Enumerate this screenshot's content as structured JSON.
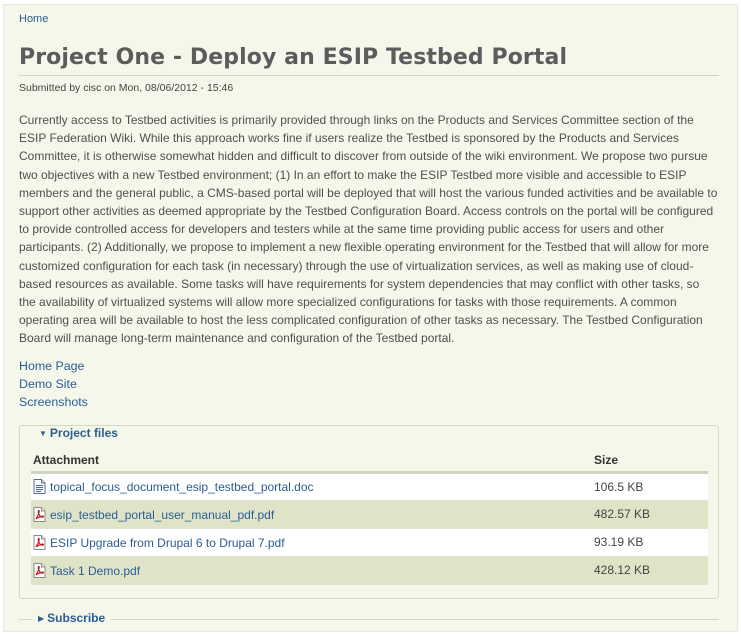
{
  "breadcrumb": {
    "home_label": "Home"
  },
  "node": {
    "title": "Project One - Deploy an ESIP Testbed Portal",
    "submitted": "Submitted by cisc on Mon, 08/06/2012 - 15:46",
    "body": "Currently access to Testbed activities is primarily provided through links on the Products and Services Committee section of the ESIP Federation Wiki. While this approach works fine if users realize the Testbed is sponsored by the Products and Services Committee, it is otherwise somewhat hidden and difficult to discover from outside of the wiki environment. We propose two pursue two objectives with a new Testbed environment; (1) In an effort to make the ESIP Testbed more visible and accessible to ESIP members and the general public, a CMS-based portal will be deployed that will host the various funded activities and be available to support other activities as deemed appropriate by the Testbed Configuration Board. Access controls on the portal will be configured to provide controlled access for developers and testers while at the same time providing public access for users and other participants. (2) Additionally, we propose to implement a new flexible operating environment for the Testbed that will allow for more customized configuration for each task (in necessary) through the use of virtualization services, as well as making use of cloud-based resources as available. Some tasks will have requirements for system dependencies that may conflict with other tasks, so the availability of virtualized systems will allow more specialized configurations for tasks with those requirements. A common operating area will be available to host the less complicated configuration of other tasks as necessary. The Testbed Configuration Board will manage long-term maintenance and configuration of the Testbed portal.",
    "links": [
      "Home Page",
      "Demo Site",
      "Screenshots"
    ]
  },
  "project_files": {
    "legend": "Project files",
    "columns": {
      "attachment": "Attachment",
      "size": "Size"
    },
    "rows": [
      {
        "name": "topical_focus_document_esip_testbed_portal.doc",
        "size": "106.5 KB",
        "icon": "doc-file-icon"
      },
      {
        "name": "esip_testbed_portal_user_manual_pdf.pdf",
        "size": "482.57 KB",
        "icon": "pdf-file-icon"
      },
      {
        "name": "ESIP Upgrade from Drupal 6 to Drupal 7.pdf",
        "size": "93.19 KB",
        "icon": "pdf-file-icon"
      },
      {
        "name": "Task 1 Demo.pdf",
        "size": "428.12 KB",
        "icon": "pdf-file-icon"
      }
    ]
  },
  "subscribe": {
    "legend": "Subscribe"
  },
  "colors": {
    "link": "#2b5d94",
    "page_bg": "#f5f7ea",
    "row_even_bg": "#dfe4c8",
    "pdf_icon": "#c4161c"
  }
}
